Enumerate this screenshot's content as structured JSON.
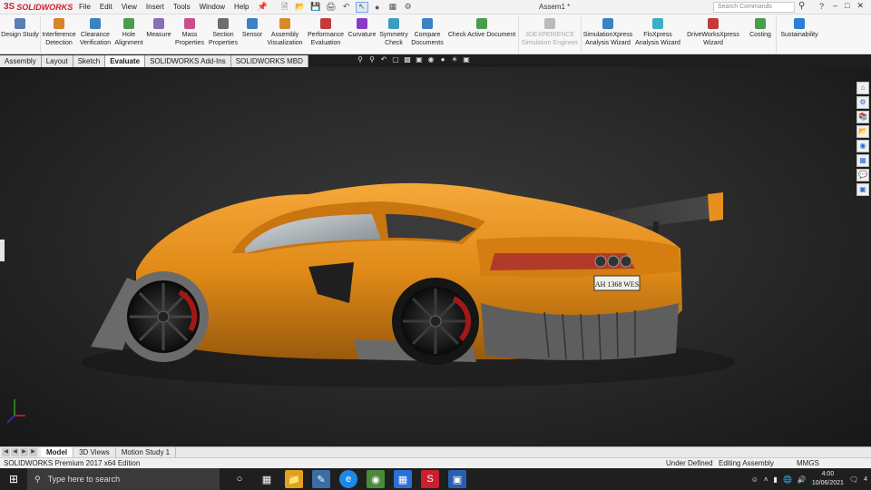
{
  "app": {
    "brand_prefix": "3S",
    "brand": "SOLIDWORKS",
    "document_title": "Assem1 *",
    "search_placeholder": "Search Commands"
  },
  "menu": [
    "File",
    "Edit",
    "View",
    "Insert",
    "Tools",
    "Window",
    "Help"
  ],
  "ribbon": [
    {
      "label1": "Design Study",
      "label2": "",
      "color": "#5a7fb5"
    },
    {
      "label1": "Interference",
      "label2": "Detection",
      "color": "#d9832b"
    },
    {
      "label1": "Clearance",
      "label2": "Verification",
      "color": "#3b82c4"
    },
    {
      "label1": "Hole",
      "label2": "Alignment",
      "color": "#4a9d4a"
    },
    {
      "label1": "Measure",
      "label2": "",
      "color": "#8a6fb8"
    },
    {
      "label1": "Mass",
      "label2": "Properties",
      "color": "#c94f8a"
    },
    {
      "label1": "Section",
      "label2": "Properties",
      "color": "#6d6d6d"
    },
    {
      "label1": "Sensor",
      "label2": "",
      "color": "#3b82c4"
    },
    {
      "label1": "Assembly",
      "label2": "Visualization",
      "color": "#d98a2b"
    },
    {
      "label1": "Performance",
      "label2": "Evaluation",
      "color": "#c43b3b"
    },
    {
      "label1": "Curvature",
      "label2": "",
      "color": "#8a3bc4"
    },
    {
      "label1": "Symmetry",
      "label2": "Check",
      "color": "#3b9dc4"
    },
    {
      "label1": "Compare",
      "label2": "Documents",
      "color": "#3b82c4"
    },
    {
      "label1": "Check Active Document",
      "label2": "",
      "color": "#4a9d4a"
    },
    {
      "label1": "3DEXPERIENCE",
      "label2": "Simulation Engineer",
      "color": "#bbbbbb",
      "disabled": true
    },
    {
      "label1": "SimulationXpress",
      "label2": "Analysis Wizard",
      "color": "#3b82c4"
    },
    {
      "label1": "FloXpress",
      "label2": "Analysis Wizard",
      "color": "#3bb0c4"
    },
    {
      "label1": "DriveWorksXpress",
      "label2": "Wizard",
      "color": "#c43b3b"
    },
    {
      "label1": "Costing",
      "label2": "",
      "color": "#4a9d4a"
    },
    {
      "label1": "Sustainability",
      "label2": "",
      "color": "#2a7fd6"
    }
  ],
  "tabs": [
    {
      "label": "Assembly",
      "active": false
    },
    {
      "label": "Layout",
      "active": false
    },
    {
      "label": "Sketch",
      "active": false
    },
    {
      "label": "Evaluate",
      "active": true
    },
    {
      "label": "SOLIDWORKS Add-Ins",
      "active": false
    },
    {
      "label": "SOLIDWORKS MBD",
      "active": false
    }
  ],
  "model": {
    "plate": "AH 1368 WES",
    "body_color": "#e8901e"
  },
  "bottom_tabs": [
    {
      "label": "Model",
      "active": true
    },
    {
      "label": "3D Views",
      "active": false
    },
    {
      "label": "Motion Study 1",
      "active": false
    }
  ],
  "status": {
    "edition": "SOLIDWORKS Premium 2017 x64 Edition",
    "defined": "Under Defined",
    "mode": "Editing Assembly",
    "units": "MMGS"
  },
  "taskbar": {
    "search_placeholder": "Type here to search",
    "time": "4:00",
    "date": "10/06/2021",
    "notifications": "4"
  }
}
